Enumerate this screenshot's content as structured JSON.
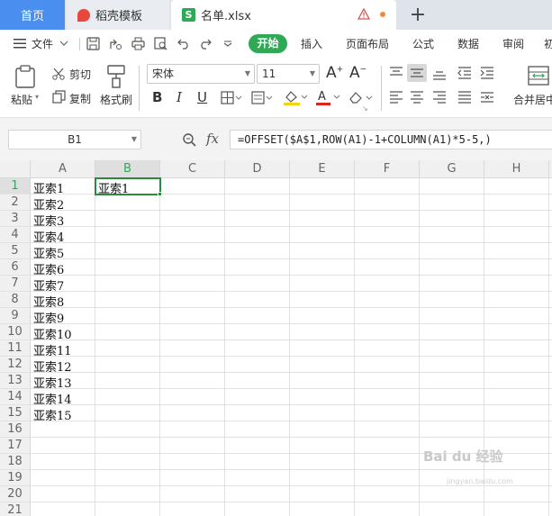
{
  "tabs": {
    "home": "首页",
    "template": "稻壳模板",
    "file": "名单.xlsx",
    "add": "+"
  },
  "menu": {
    "file": "文件",
    "start": "开始",
    "insert": "插入",
    "page_layout": "页面布局",
    "formula": "公式",
    "data": "数据",
    "review": "审阅",
    "view_cut": "初"
  },
  "ribbon": {
    "paste": "粘贴",
    "cut": "剪切",
    "copy": "复制",
    "format_painter": "格式刷",
    "font_name": "宋体",
    "font_size": "11",
    "bold": "B",
    "italic": "I",
    "underline": "U",
    "merge_center": "合并居中"
  },
  "formula_bar": {
    "name_box": "B1",
    "fx": "fx",
    "formula": "=OFFSET($A$1,ROW(A1)-1+COLUMN(A1)*5-5,)"
  },
  "sheet": {
    "columns": [
      "A",
      "B",
      "C",
      "D",
      "E",
      "F",
      "G",
      "H"
    ],
    "rows": [
      "1",
      "2",
      "3",
      "4",
      "5",
      "6",
      "7",
      "8",
      "9",
      "10",
      "11",
      "12",
      "13",
      "14",
      "15",
      "16",
      "17",
      "18",
      "19",
      "20",
      "21"
    ],
    "column_a": [
      "亚索1",
      "亚索2",
      "亚索3",
      "亚索4",
      "亚索5",
      "亚索6",
      "亚索7",
      "亚索8",
      "亚索9",
      "亚索10",
      "亚索11",
      "亚索12",
      "亚索13",
      "亚索14",
      "亚索15"
    ],
    "b1": "亚索1",
    "active_cell": "B1"
  },
  "watermark": {
    "text": "Bai du 经验",
    "sub": "jingyan.baidu.com"
  },
  "colors": {
    "accent": "#2fa956",
    "tab_home": "#4a8ef0"
  }
}
